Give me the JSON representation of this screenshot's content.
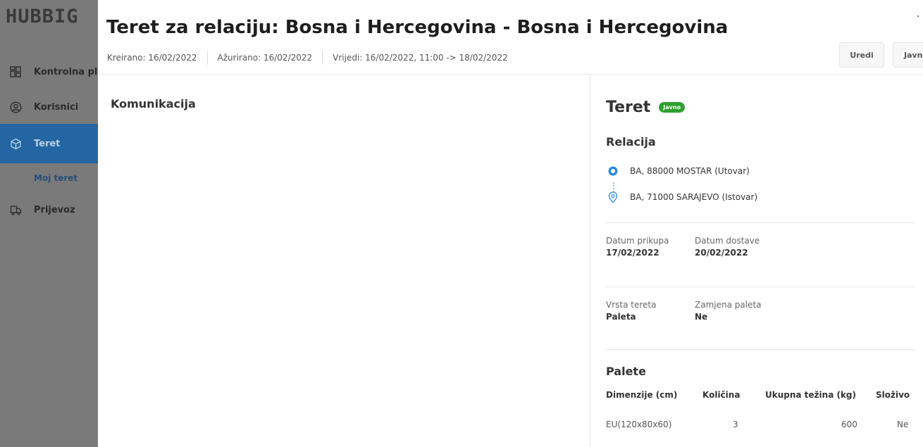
{
  "sidebar": {
    "logo": "HUBBIG",
    "items": [
      {
        "label": "Kontrolna pl",
        "icon": "dashboard-icon"
      },
      {
        "label": "Korisnici",
        "icon": "user-circle-icon"
      },
      {
        "label": "Teret",
        "icon": "box-icon",
        "active": true
      },
      {
        "label": "Prijevoz",
        "icon": "truck-icon"
      }
    ],
    "subitem": "Moj teret"
  },
  "header": {
    "title": "Teret za relaciju: Bosna i Hercegovina - Bosna i Hercegovina",
    "created": "Kreirano: 16/02/2022",
    "updated": "Ažurirano: 16/02/2022",
    "valid": "Vrijedi: 16/02/2022, 11:00 -> 18/02/2022",
    "edit_button": "Uredi",
    "public_button": "Javno"
  },
  "left": {
    "title": "Komunikacija"
  },
  "right": {
    "title": "Teret",
    "badge": "Javno",
    "route_title": "Relacija",
    "route": [
      {
        "text": "BA, 88000 MOSTAR (Utovar)",
        "icon": "origin-pin-icon"
      },
      {
        "text": "BA, 71000 SARAJEVO (Istovar)",
        "icon": "destination-pin-icon"
      }
    ],
    "pickup_label": "Datum prikupa",
    "pickup_value": "17/02/2022",
    "delivery_label": "Datum dostave",
    "delivery_value": "20/02/2022",
    "cargo_type_label": "Vrsta tereta",
    "cargo_type_value": "Paleta",
    "pallet_swap_label": "Zamjena paleta",
    "pallet_swap_value": "Ne",
    "pallets_title": "Palete",
    "table": {
      "headers": [
        "Dimenzije (cm)",
        "Količina",
        "Ukupna težina (kg)",
        "Složivo"
      ],
      "rows": [
        [
          "EU(120x80x60)",
          "3",
          "600",
          "Ne"
        ]
      ]
    }
  },
  "colors": {
    "sidebar_bg": "#7a7a7a",
    "active_nav": "#2366a3",
    "badge_green": "#2fa02f",
    "pin_blue": "#2d8ae0"
  }
}
